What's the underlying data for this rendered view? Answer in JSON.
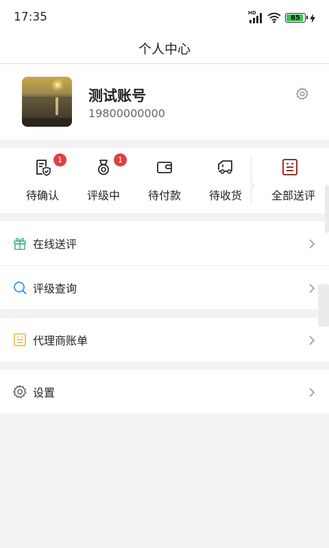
{
  "status_bar": {
    "time": "17:35",
    "network_label": "HD",
    "battery": "85",
    "battery_level": 0.85
  },
  "nav": {
    "title": "个人中心"
  },
  "profile": {
    "name": "测试账号",
    "phone": "19800000000",
    "settings_icon": "gear-icon"
  },
  "orders": {
    "items": [
      {
        "label": "待确认",
        "badge": "1",
        "icon": "document-check-icon"
      },
      {
        "label": "评级中",
        "badge": "1",
        "icon": "medal-icon"
      },
      {
        "label": "待付款",
        "icon": "wallet-icon"
      },
      {
        "label": "待收货",
        "icon": "truck-icon"
      }
    ],
    "all": {
      "label": "全部送评",
      "icon": "list-box-icon",
      "color": "#9b2d2d"
    }
  },
  "menu": {
    "group1": [
      {
        "label": "在线送评",
        "icon": "gift-icon",
        "color": "#3fb38a"
      },
      {
        "label": "评级查询",
        "icon": "search-icon",
        "color": "#2f8de4"
      }
    ],
    "group2": [
      {
        "label": "代理商账单",
        "icon": "bill-icon",
        "color": "#e7b43c"
      }
    ],
    "group3": [
      {
        "label": "设置",
        "icon": "gear-icon",
        "color": "#555555"
      }
    ]
  }
}
